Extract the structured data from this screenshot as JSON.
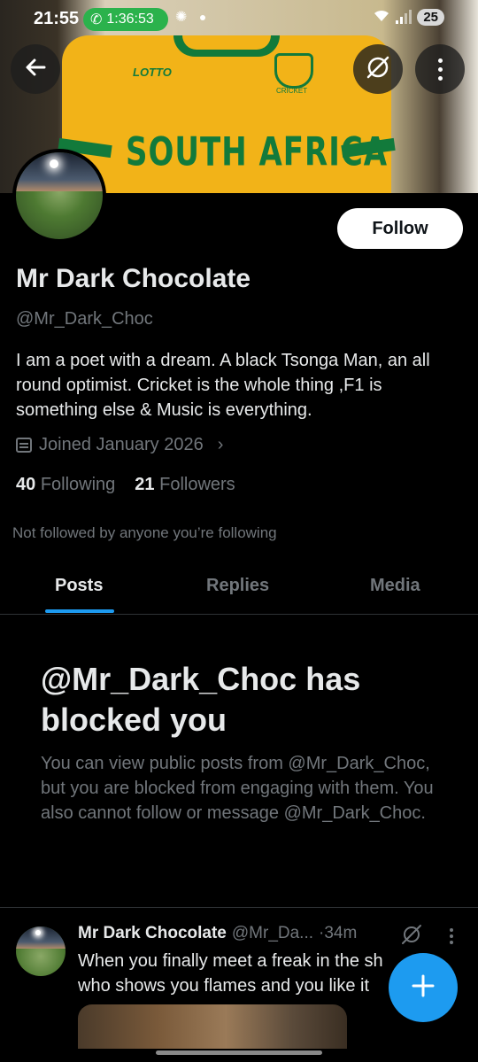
{
  "status_bar": {
    "time": "21:55",
    "call_timer": "1:36:53",
    "battery": "25"
  },
  "banner": {
    "brand": "LOTTO",
    "crest_text": "CRICKET",
    "jersey_text": "SOUTH AFRICA"
  },
  "profile": {
    "follow_label": "Follow",
    "name": "Mr Dark Chocolate",
    "handle": "@Mr_Dark_Choc",
    "bio": "I am a poet with a dream. A black Tsonga Man, an all round optimist. Cricket is the whole thing ,F1 is something else & Music is everything.",
    "joined": "Joined January 2026",
    "following_count": "40",
    "following_label": "Following",
    "followers_count": "21",
    "followers_label": "Followers",
    "not_followed": "Not followed by anyone you’re following"
  },
  "tabs": [
    {
      "label": "Posts",
      "active": true
    },
    {
      "label": "Replies",
      "active": false
    },
    {
      "label": "Media",
      "active": false
    }
  ],
  "blocked": {
    "title": "@Mr_Dark_Choc has blocked you",
    "text": "You can view public posts from @Mr_Dark_Choc, but you are blocked from engaging with them. You also cannot follow or message @Mr_Dark_Choc."
  },
  "post": {
    "name": "Mr Dark Chocolate",
    "handle": "@Mr_Da...",
    "time": "·34m",
    "text_line1": "When you finally meet a freak in the sh",
    "text_line2": "who shows you flames and you like it"
  },
  "colors": {
    "accent": "#1d9bf0",
    "background": "#000000",
    "secondary_text": "#71767b",
    "call_green": "#2bb24c"
  },
  "icons": [
    "back-arrow-icon",
    "grok-icon",
    "more-vertical-icon",
    "calendar-icon",
    "chevron-right-icon",
    "plus-icon",
    "phone-icon",
    "wifi-icon",
    "signal-icon"
  ]
}
